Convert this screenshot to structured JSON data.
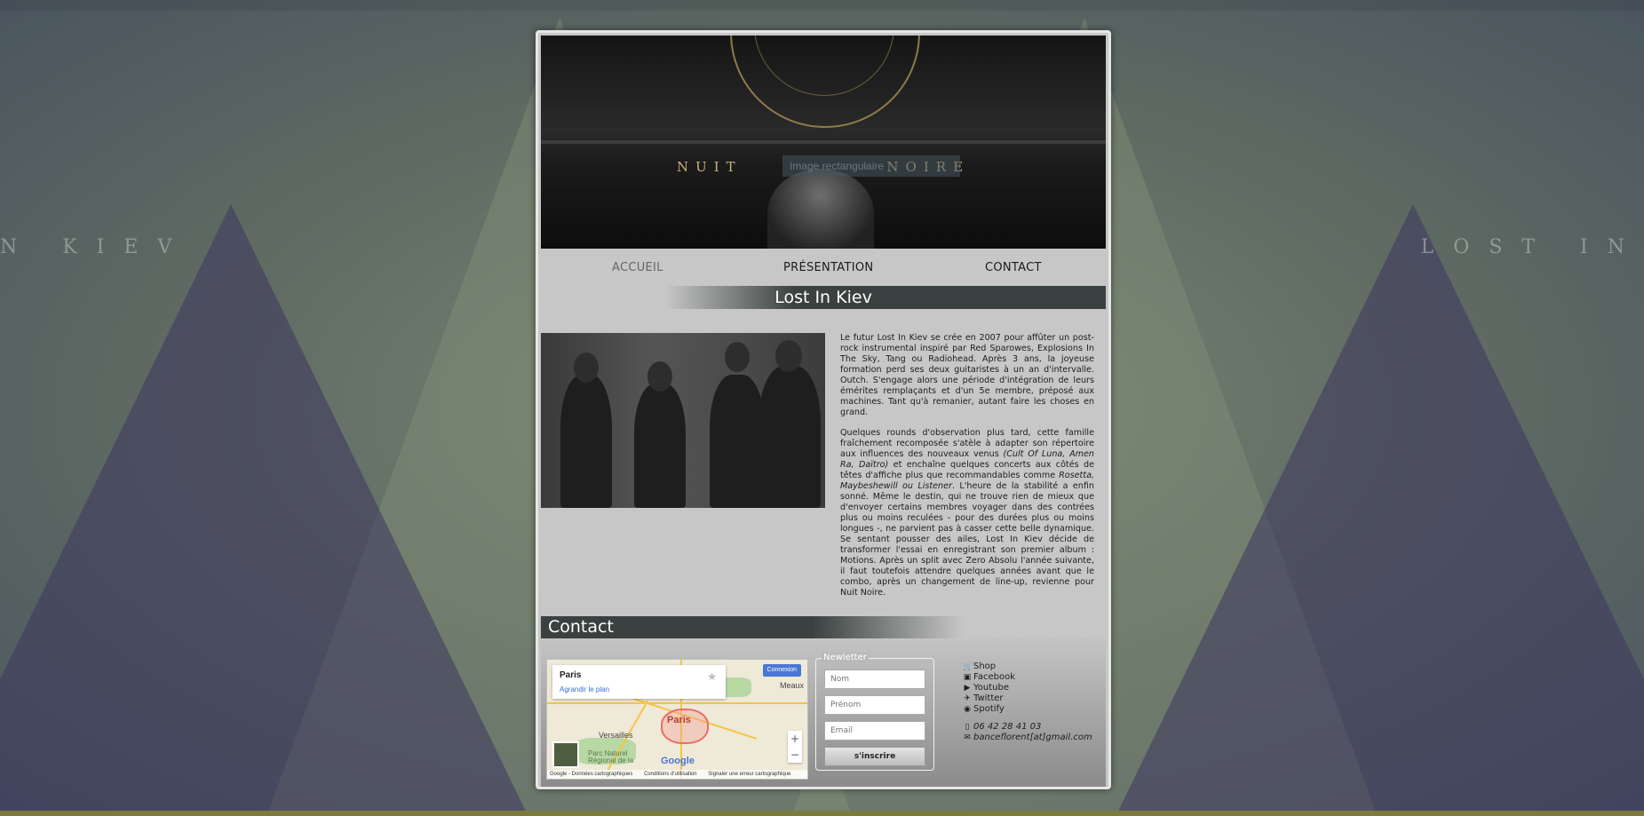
{
  "background": {
    "left_text": "N   KIEV",
    "right_text": "LOST IN"
  },
  "banner": {
    "title": "NUIT NOIRE",
    "placeholder": "Image rectangulaire"
  },
  "nav": {
    "home": "ACCUEIL",
    "presentation": "PRÉSENTATION",
    "contact": "CONTACT"
  },
  "artist": {
    "title": "Lost In Kiev",
    "p1": "Le futur Lost In Kiev se crée en 2007 pour affûter un post-rock instrumental inspiré par Red Sparowes, Explosions In The Sky, Tang ou Radiohead. Après 3 ans, la joyeuse formation perd ses deux guitaristes à un an d'intervalle. Outch. S'engage alors une période d'intégration de leurs émérites remplaçants et d'un 5e membre, préposé aux machines. Tant qu'à remanier, autant faire les choses en grand.",
    "p2_a": "Quelques rounds d'observation plus tard, cette famille fraîchement recomposée s'atèle à adapter son répertoire aux influences des nouveaux venus ",
    "p2_b": "(Cult Of Luna, Amen Ra, Daïtro)",
    "p2_c": " et enchaîne quelques concerts aux côtés de têtes d'affiche plus que recommandables comme ",
    "p2_d": "Rosetta, Maybeshewill ou Listener",
    "p2_e": ". L'heure de la stabilité a enfin sonné. Même le destin, qui ne trouve rien de mieux que d'envoyer certains membres voyager dans des contrées plus ou moins reculées - pour des durées plus ou moins longues -, ne parvient pas à casser cette belle dynamique. Se sentant pousser des ailes, Lost In Kiev décide de transformer l'essai en enregistrant son premier album : Motions. Après un split avec Zero Absolu l'année suivante, il faut toutefois attendre quelques années avant que le combo, après un changement de line-up, revienne pour Nuit Noire."
  },
  "contact": {
    "title": "Contact",
    "map": {
      "place_name": "Paris",
      "enlarge": "Agrandir le plan",
      "login": "Connexion",
      "city_label": "Paris",
      "versailles": "Versailles",
      "meaux": "Meaux",
      "park": "Parc Naturel Régional de la",
      "google": "Google",
      "attr1": "Google - Données cartographiques",
      "attr2": "Conditions d'utilisation",
      "attr3": "Signaler une erreur cartographique"
    },
    "newsletter": {
      "legend": "Newletter",
      "nom": "Nom",
      "prenom": "Prénom",
      "email": "Email",
      "submit": "s'inscrire"
    },
    "links": [
      "Shop",
      "Facebook",
      "Youtube",
      "Twitter",
      "Spotify"
    ],
    "phone": "06 42 28 41 03",
    "email": "banceflorent[at]gmail.com"
  }
}
